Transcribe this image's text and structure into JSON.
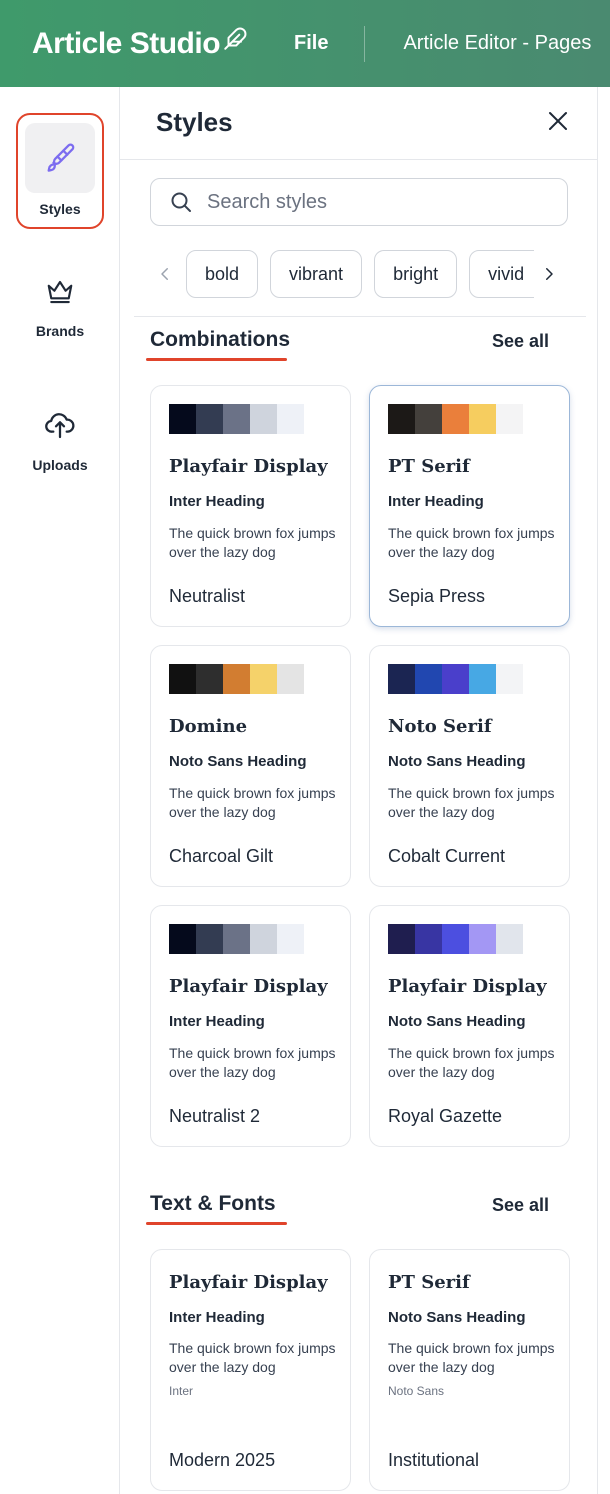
{
  "header": {
    "logo_text": "Article Studio",
    "menu_file": "File",
    "document_title": "Article Editor - Pages"
  },
  "rail": {
    "items": [
      {
        "label": "Styles",
        "icon": "paintbrush-icon",
        "active": true
      },
      {
        "label": "Brands",
        "icon": "crown-icon"
      },
      {
        "label": "Uploads",
        "icon": "cloud-upload-icon"
      }
    ]
  },
  "panel": {
    "title": "Styles",
    "search": {
      "placeholder": "Search styles"
    },
    "chips": [
      "bold",
      "vibrant",
      "bright",
      "vivid"
    ]
  },
  "sections": {
    "combinations": {
      "title": "Combinations",
      "see_all": "See all",
      "cards": [
        {
          "font": "Playfair Display",
          "heading": "Inter Heading",
          "sample": "The quick brown fox jumps over the lazy dog",
          "name": "Neutralist",
          "swatches": [
            "#050a1c",
            "#333c52",
            "#6b7287",
            "#cfd4dd",
            "#eef1f7"
          ]
        },
        {
          "font": "PT Serif",
          "heading": "Inter Heading",
          "sample": "The quick brown fox jumps over the lazy dog",
          "name": "Sepia Press",
          "swatches": [
            "#1c1917",
            "#44403c",
            "#ea7f3b",
            "#f6cd5f",
            "#f4f4f5"
          ]
        },
        {
          "font": "Domine",
          "heading": "Noto Sans Heading",
          "sample": "The quick brown fox jumps over the lazy dog",
          "name": "Charcoal Gilt",
          "swatches": [
            "#111111",
            "#2e2e2e",
            "#d27d31",
            "#f5d26a",
            "#e4e4e4"
          ]
        },
        {
          "font": "Noto Serif",
          "heading": "Noto Sans Heading",
          "sample": "The quick brown fox jumps over the lazy dog",
          "name": "Cobalt Current",
          "swatches": [
            "#1b2552",
            "#2147b0",
            "#4a3fcb",
            "#47a8e4",
            "#f3f4f6"
          ]
        },
        {
          "font": "Playfair Display",
          "heading": "Inter Heading",
          "sample": "The quick brown fox jumps over the lazy dog",
          "name": "Neutralist 2",
          "swatches": [
            "#050a1c",
            "#333c52",
            "#6b7287",
            "#cfd4dd",
            "#eef1f7"
          ]
        },
        {
          "font": "Playfair Display",
          "heading": "Noto Sans Heading",
          "sample": "The quick brown fox jumps over the lazy dog",
          "name": "Royal Gazette",
          "swatches": [
            "#1f1e4f",
            "#3835a3",
            "#4c4fe0",
            "#a397f4",
            "#e1e5ec"
          ]
        }
      ]
    },
    "text_fonts": {
      "title": "Text & Fonts",
      "see_all": "See all",
      "cards": [
        {
          "font": "Playfair Display",
          "heading": "Inter Heading",
          "sample": "The quick brown fox jumps over the lazy dog",
          "caption": "Inter",
          "name": "Modern 2025"
        },
        {
          "font": "PT Serif",
          "heading": "Noto Sans Heading",
          "sample": "The quick brown fox jumps over the lazy dog",
          "caption": "Noto Sans",
          "name": "Institutional"
        }
      ]
    }
  },
  "colors": {
    "header_green": "#3f9a6b",
    "accent_red": "#e0442b",
    "active_icon_purple": "#7c6cf0"
  }
}
